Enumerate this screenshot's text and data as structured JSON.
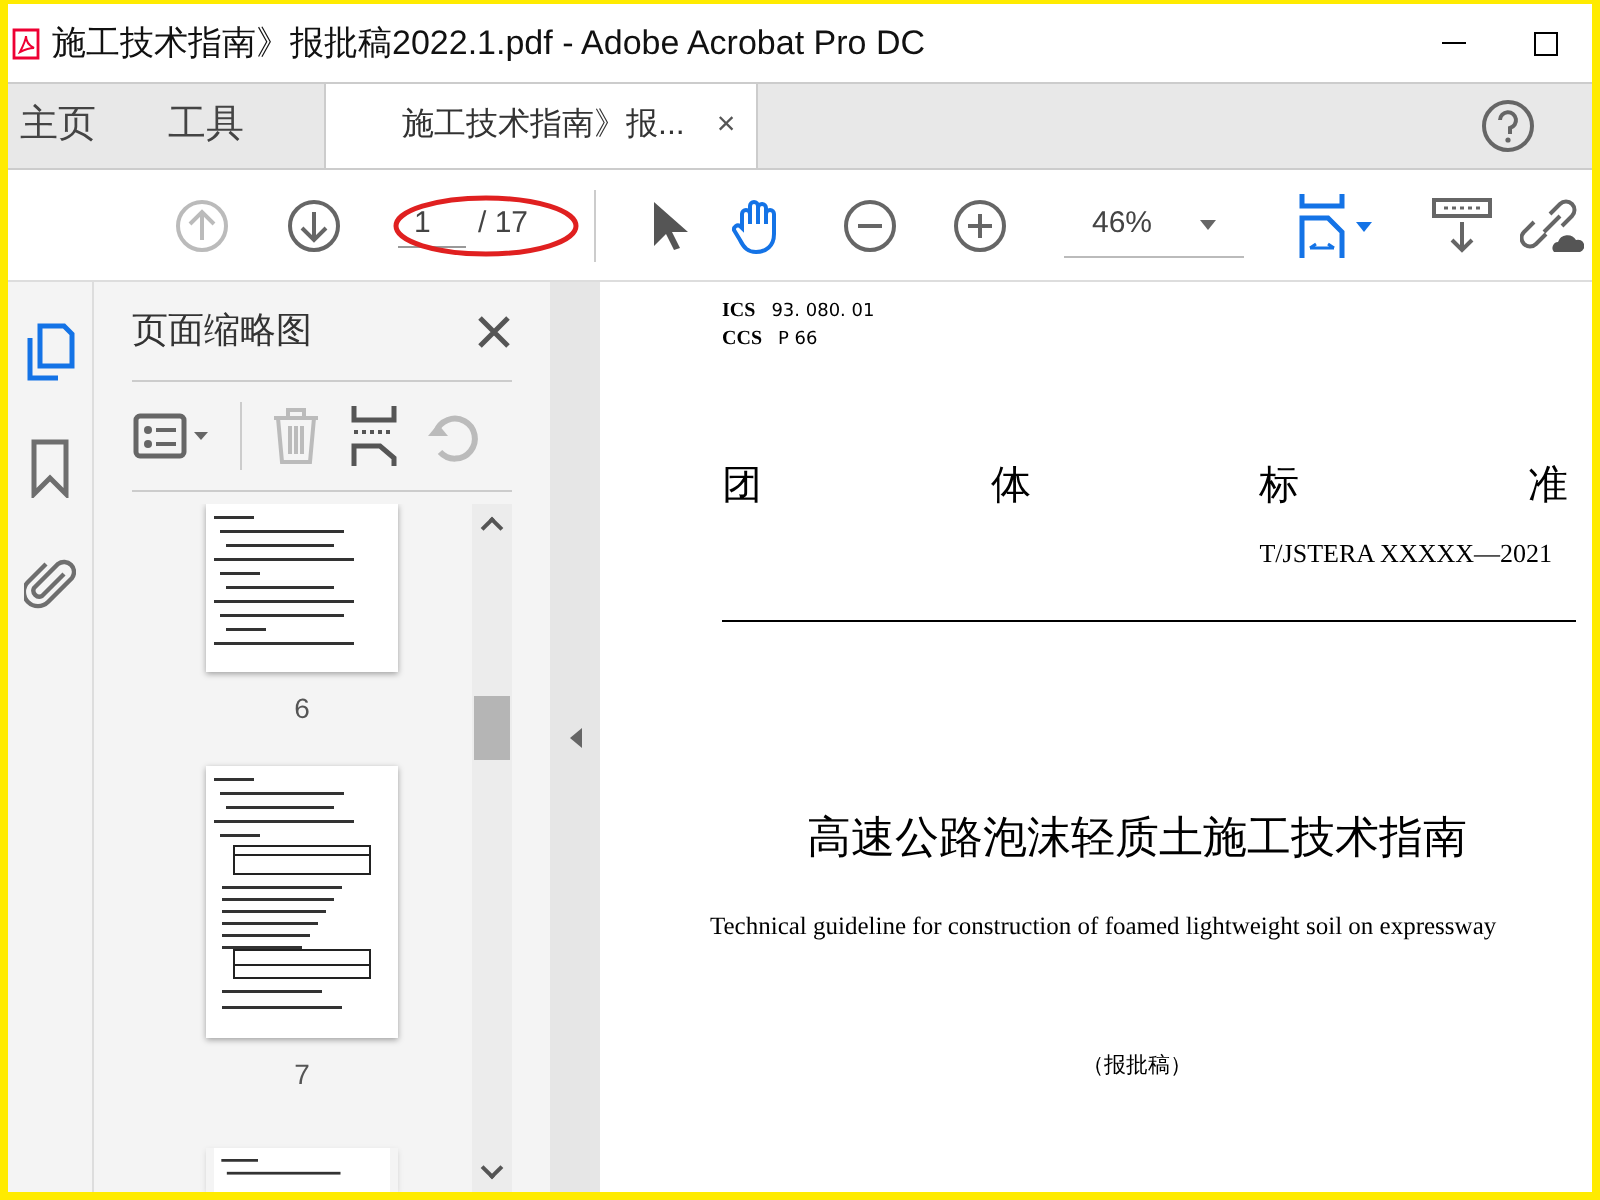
{
  "window": {
    "title": "施工技术指南》报批稿2022.1.pdf - Adobe Acrobat Pro DC"
  },
  "tabs": [
    {
      "label": "主页",
      "selected": false,
      "kind": "nav"
    },
    {
      "label": "工具",
      "selected": false,
      "kind": "nav"
    },
    {
      "label": "施工技术指南》报...",
      "selected": true,
      "kind": "document",
      "close": "×"
    }
  ],
  "toolbar": {
    "page_current": "1",
    "page_total": "/ 17",
    "zoom": "46%"
  },
  "sidebar": {
    "items": [
      {
        "kind": "pages",
        "selected": true
      },
      {
        "kind": "bookmarks",
        "selected": false
      },
      {
        "kind": "attachments",
        "selected": false
      }
    ]
  },
  "thumbnail_panel": {
    "title": "页面缩略图",
    "thumbnails": [
      {
        "label": "6",
        "kind": "text"
      },
      {
        "label": "7",
        "kind": "tables"
      },
      {
        "kind": "partial"
      }
    ]
  },
  "document": {
    "codes": [
      {
        "label": "ICS",
        "value": "93. 080. 01"
      },
      {
        "label": "CCS",
        "value": "P 66"
      }
    ],
    "heading": [
      "团",
      "体",
      "标",
      "准"
    ],
    "standard_number": "T/JSTERA  XXXXX—2021",
    "title": "高速公路泡沫轻质土施工技术指南",
    "subtitle": "Technical guideline for construction of foamed lightweight soil on expressway",
    "status": "（报批稿）"
  }
}
